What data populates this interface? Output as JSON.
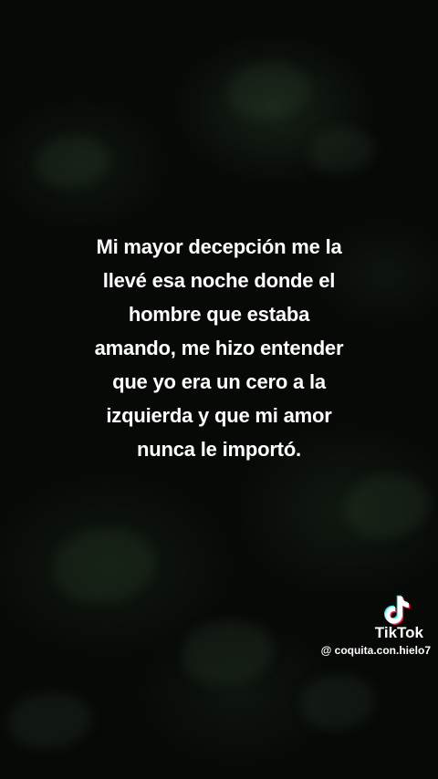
{
  "message": {
    "lines": [
      "Mi mayor decepción me la",
      "llevé esa noche donde el",
      "hombre que estaba",
      "amando, me hizo entender",
      "que yo era un cero a la",
      "izquierda y que mi amor",
      "nunca le importó."
    ]
  },
  "watermark": {
    "brand": "TikTok",
    "handle": "@ coquita.con.hielo7",
    "icon": "tiktok-logo-icon"
  },
  "colors": {
    "background": "#070907",
    "text": "#ffffff",
    "logo_cyan": "#25f4ee",
    "logo_red": "#fe2c55"
  }
}
